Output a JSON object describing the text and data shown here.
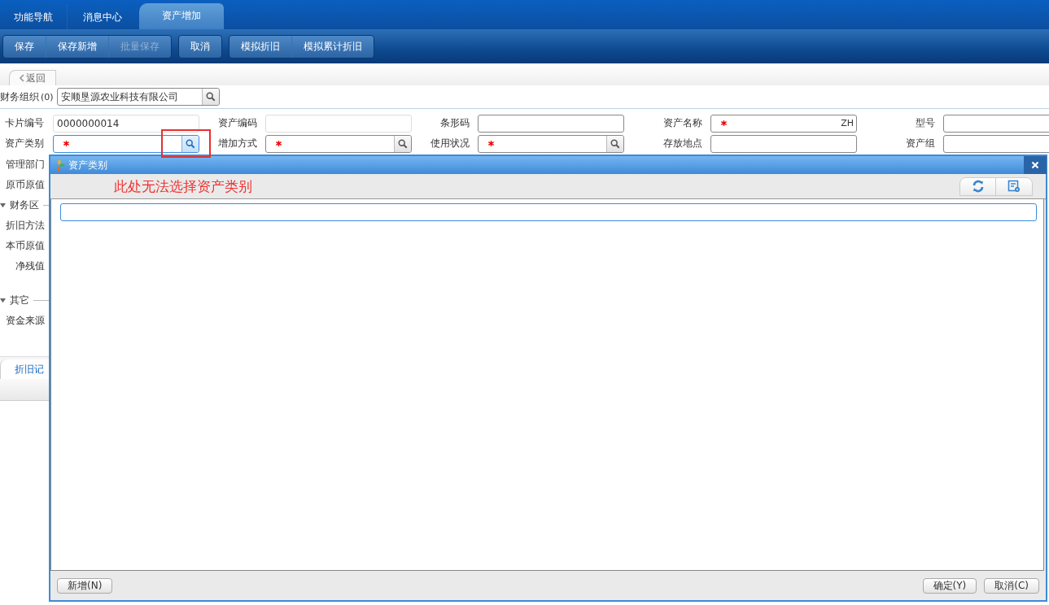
{
  "nav_tabs": [
    {
      "label": "功能导航",
      "selected": false
    },
    {
      "label": "消息中心",
      "selected": false
    },
    {
      "label": "资产增加",
      "selected": true
    }
  ],
  "toolbar_groups": [
    [
      {
        "label": "保存",
        "disabled": false
      },
      {
        "label": "保存新增",
        "disabled": false
      },
      {
        "label": "批量保存",
        "disabled": true
      }
    ],
    [
      {
        "label": "取消",
        "disabled": false
      }
    ],
    [
      {
        "label": "模拟折旧",
        "disabled": false
      },
      {
        "label": "模拟累计折旧",
        "disabled": false
      }
    ]
  ],
  "back_button": "返回",
  "org": {
    "label": "财务组织",
    "count": "(0)",
    "value": "安顺垦源农业科技有限公司"
  },
  "form_rows": [
    [
      {
        "label": "卡片编号",
        "value": "0000000014",
        "kind": "text",
        "readonly": true,
        "required": false
      },
      {
        "label": "资产编码",
        "kind": "text",
        "readonly": true,
        "required": false
      },
      {
        "label": "条形码",
        "kind": "text",
        "readonly": false,
        "required": false
      },
      {
        "label": "资产名称",
        "value": "ZH",
        "kind": "text",
        "readonly": false,
        "required": true
      },
      {
        "label": "型号",
        "kind": "text",
        "readonly": false,
        "required": false
      }
    ],
    [
      {
        "label": "资产类别",
        "kind": "lookup",
        "readonly": false,
        "required": true,
        "focused": true,
        "highlighted": true
      },
      {
        "label": "增加方式",
        "kind": "lookup",
        "readonly": false,
        "required": true
      },
      {
        "label": "使用状况",
        "kind": "lookup",
        "readonly": false,
        "required": true
      },
      {
        "label": "存放地点",
        "kind": "text",
        "readonly": false,
        "required": false
      },
      {
        "label": "资产组",
        "kind": "text",
        "readonly": false,
        "required": false
      }
    ]
  ],
  "main_labels": [
    "管理部门",
    "原币原值"
  ],
  "sections": [
    {
      "title": "财务区",
      "expanded": true,
      "labels": [
        "折旧方法",
        "本币原值",
        "净残值"
      ]
    },
    {
      "title": "其它",
      "expanded": true,
      "labels": [
        "资金来源"
      ]
    }
  ],
  "bottom_tab": "折旧记",
  "dialog": {
    "title": "资产类别",
    "annotation": "此处无法选择资产类别",
    "left_buttons": [
      "新增(N)"
    ],
    "right_buttons": [
      "确定(Y)",
      "取消(C)"
    ]
  }
}
